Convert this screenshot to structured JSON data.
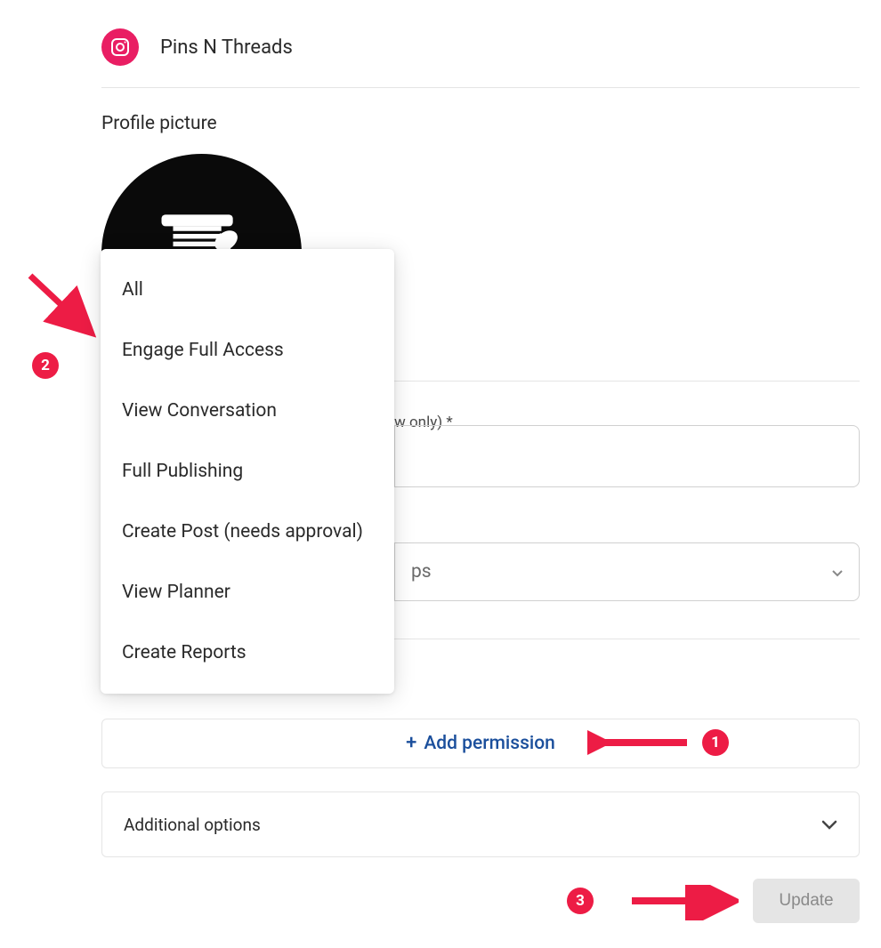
{
  "header": {
    "account_name": "Pins N Threads"
  },
  "profile_picture_label": "Profile picture",
  "dropdown": {
    "items": [
      "All",
      "Engage Full Access",
      "View Conversation",
      "Full Publishing",
      "Create Post (needs approval)",
      "View Planner",
      "Create Reports"
    ]
  },
  "field_label_partial": "w only) *",
  "groups_placeholder": "ps",
  "add_permission_label": "Add permission",
  "additional_options_label": "Additional options",
  "update_label": "Update",
  "annotations": {
    "badge1": "1",
    "badge2": "2",
    "badge3": "3"
  }
}
